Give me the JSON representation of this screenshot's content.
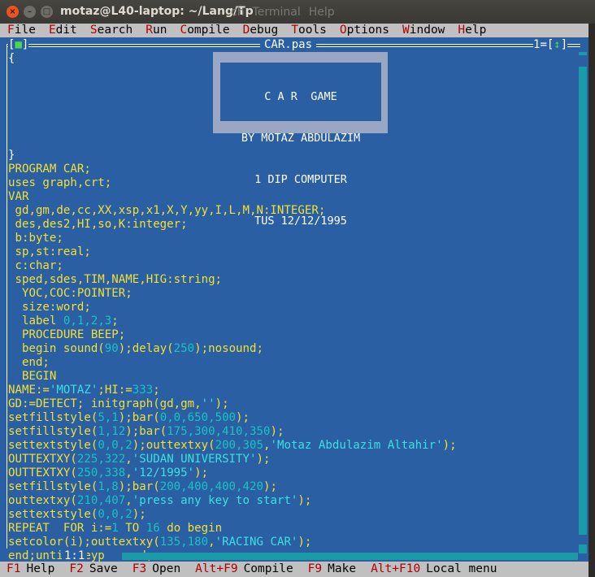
{
  "window": {
    "title": "motaz@L40-laptop: ~/Lang/Tp",
    "ghost_menu": [
      "Search",
      "Terminal",
      "Help"
    ],
    "ghost_prefix": "ch"
  },
  "menubar": [
    {
      "hk": "F",
      "rest": "ile"
    },
    {
      "hk": "E",
      "rest": "dit"
    },
    {
      "hk": "S",
      "rest": "earch"
    },
    {
      "hk": "R",
      "rest": "un"
    },
    {
      "hk": "C",
      "rest": "ompile"
    },
    {
      "hk": "D",
      "rest": "ebug"
    },
    {
      "hk": "T",
      "rest": "ools"
    },
    {
      "hk": "O",
      "rest": "ptions"
    },
    {
      "hk": "W",
      "rest": "indow"
    },
    {
      "hk": "H",
      "rest": "elp"
    }
  ],
  "editor": {
    "filename": "CAR.pas",
    "close_box": "[■]",
    "window_number": "1",
    "zoom_icon": "↕",
    "cursor_position": "1:1"
  },
  "comment_box": [
    "C A R  GAME",
    "BY MOTAZ ABDULAZIM",
    "1 DIP COMPUTER",
    "TUS 12/12/1995"
  ],
  "code_lines": [
    [
      [
        "w",
        "{"
      ]
    ],
    [],
    [],
    [],
    [],
    [],
    [],
    [
      [
        "w",
        "}"
      ]
    ],
    [
      [
        "d",
        "PROGRAM CAR;"
      ]
    ],
    [
      [
        "d",
        "uses graph,crt;"
      ]
    ],
    [
      [
        "d",
        "VAR"
      ]
    ],
    [
      [
        "d",
        " gd,gm,de,cc,XX,xsp,x1,X,Y,yy,I,L,M,N:INTEGER;"
      ]
    ],
    [
      [
        "d",
        " des,des2,HI,so,K:integer;"
      ]
    ],
    [
      [
        "d",
        " b:byte;"
      ]
    ],
    [
      [
        "d",
        " sp,st:real;"
      ]
    ],
    [
      [
        "d",
        " c:char;"
      ]
    ],
    [
      [
        "d",
        " sped,sdes,TIM,NAME,HIG:string;"
      ]
    ],
    [
      [
        "d",
        "  YOC,COC:POINTER;"
      ]
    ],
    [
      [
        "d",
        "  size:word;"
      ]
    ],
    [
      [
        "d",
        "  label "
      ],
      [
        "n",
        "0,1,2,3"
      ],
      [
        "d",
        ";"
      ]
    ],
    [
      [
        "d",
        "  PROCEDURE BEEP;"
      ]
    ],
    [
      [
        "d",
        "  begin sound("
      ],
      [
        "n",
        "90"
      ],
      [
        "d",
        ");delay("
      ],
      [
        "n",
        "250"
      ],
      [
        "d",
        ");nosound;"
      ]
    ],
    [
      [
        "d",
        "  end;"
      ]
    ],
    [
      [
        "d",
        "  BEGIN"
      ]
    ],
    [
      [
        "d",
        "NAME:="
      ],
      [
        "s",
        "'MOTAZ'"
      ],
      [
        "d",
        ";HI:="
      ],
      [
        "n",
        "333"
      ],
      [
        "d",
        ";"
      ]
    ],
    [
      [
        "d",
        "GD:=DETECT; initgraph(gd,gm,"
      ],
      [
        "s",
        "''"
      ],
      [
        "d",
        ");"
      ]
    ],
    [
      [
        "d",
        "setfillstyle("
      ],
      [
        "n",
        "5,1"
      ],
      [
        "d",
        ");bar("
      ],
      [
        "n",
        "0,0,650,500"
      ],
      [
        "d",
        ");"
      ]
    ],
    [
      [
        "d",
        "setfillstyle("
      ],
      [
        "n",
        "1,12"
      ],
      [
        "d",
        ");bar("
      ],
      [
        "n",
        "175,300,410,350"
      ],
      [
        "d",
        ");"
      ]
    ],
    [
      [
        "d",
        "settextstyle("
      ],
      [
        "n",
        "0,0,2"
      ],
      [
        "d",
        ");outtextxy("
      ],
      [
        "n",
        "200,305"
      ],
      [
        "d",
        ","
      ],
      [
        "s",
        "'Motaz Abdulazim Altahir'"
      ],
      [
        "d",
        ");"
      ]
    ],
    [
      [
        "d",
        "OUTTEXTXY("
      ],
      [
        "n",
        "225,322"
      ],
      [
        "d",
        ","
      ],
      [
        "s",
        "'SUDAN UNIVERSITY'"
      ],
      [
        "d",
        ");"
      ]
    ],
    [
      [
        "d",
        "OUTTEXTXY("
      ],
      [
        "n",
        "250,338"
      ],
      [
        "d",
        ","
      ],
      [
        "s",
        "'12/1995'"
      ],
      [
        "d",
        ");"
      ]
    ],
    [
      [
        "d",
        "setfillstyle("
      ],
      [
        "n",
        "1,8"
      ],
      [
        "d",
        ");bar("
      ],
      [
        "n",
        "200,400,400,420"
      ],
      [
        "d",
        ");"
      ]
    ],
    [
      [
        "d",
        "outtextxy("
      ],
      [
        "n",
        "210,407"
      ],
      [
        "d",
        ","
      ],
      [
        "s",
        "'press any key to start'"
      ],
      [
        "d",
        ");"
      ]
    ],
    [
      [
        "d",
        "settextstyle("
      ],
      [
        "n",
        "0,0,2"
      ],
      [
        "d",
        ");"
      ]
    ],
    [
      [
        "d",
        "REPEAT  FOR i:="
      ],
      [
        "n",
        "1"
      ],
      [
        "d",
        " TO "
      ],
      [
        "n",
        "16"
      ],
      [
        "d",
        " do begin"
      ]
    ],
    [
      [
        "d",
        "setcolor(i);outtextxy("
      ],
      [
        "n",
        "135,180"
      ],
      [
        "d",
        ","
      ],
      [
        "s",
        "'RACING CAR'"
      ],
      [
        "d",
        ");"
      ]
    ],
    [
      [
        "d",
        "end;until keypressed;"
      ]
    ]
  ],
  "statusbar": [
    {
      "key": "F1",
      "label": "Help"
    },
    {
      "key": "F2",
      "label": "Save"
    },
    {
      "key": "F3",
      "label": "Open"
    },
    {
      "key": "Alt+F9",
      "label": "Compile"
    },
    {
      "key": "F9",
      "label": "Make"
    },
    {
      "key": "Alt+F10",
      "label": "Local menu"
    }
  ],
  "colors": {
    "editor_bg": "#2a5fa3",
    "default_text": "#f2e033",
    "number_text": "#19c3c3",
    "string_text": "#3de0e0",
    "menu_bg": "#c0c0c0",
    "hotkey": "#b00000"
  }
}
